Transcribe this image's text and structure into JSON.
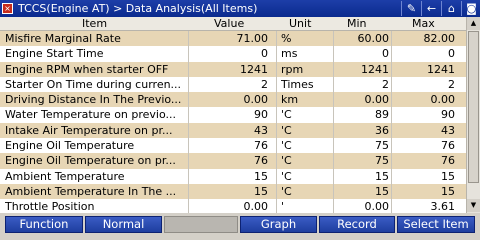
{
  "titlebar": {
    "title": "TCCS(Engine AT) > Data Analysis(All Items)",
    "back_glyph": "×",
    "icons": [
      "pencil-icon",
      "back-arrow-icon",
      "home-icon",
      "camera-icon"
    ],
    "icon_glyphs": [
      "✎",
      "←",
      "⌂",
      "◙"
    ]
  },
  "table": {
    "headers": {
      "item": "Item",
      "value": "Value",
      "unit": "Unit",
      "min": "Min",
      "max": "Max"
    },
    "rows": [
      {
        "item": "Misfire Marginal Rate",
        "value": "71.00",
        "unit": "%",
        "min": "60.00",
        "max": "82.00"
      },
      {
        "item": "Engine Start Time",
        "value": "0",
        "unit": "ms",
        "min": "0",
        "max": "0"
      },
      {
        "item": "Engine RPM when starter OFF",
        "value": "1241",
        "unit": "rpm",
        "min": "1241",
        "max": "1241"
      },
      {
        "item": "Starter On Time during curren...",
        "value": "2",
        "unit": "Times",
        "min": "2",
        "max": "2"
      },
      {
        "item": "Driving Distance In The Previo...",
        "value": "0.00",
        "unit": "km",
        "min": "0.00",
        "max": "0.00"
      },
      {
        "item": "Water Temperature on previo...",
        "value": "90",
        "unit": "'C",
        "min": "89",
        "max": "90"
      },
      {
        "item": "Intake Air Temperature on pr...",
        "value": "43",
        "unit": "'C",
        "min": "36",
        "max": "43"
      },
      {
        "item": "Engine Oil Temperature",
        "value": "76",
        "unit": "'C",
        "min": "75",
        "max": "76"
      },
      {
        "item": "Engine Oil Temperature on pr...",
        "value": "76",
        "unit": "'C",
        "min": "75",
        "max": "76"
      },
      {
        "item": "Ambient Temperature",
        "value": "15",
        "unit": "'C",
        "min": "15",
        "max": "15"
      },
      {
        "item": "Ambient Temperature In The ...",
        "value": "15",
        "unit": "'C",
        "min": "15",
        "max": "15"
      },
      {
        "item": "Throttle Position",
        "value": "0.00",
        "unit": "'",
        "min": "0.00",
        "max": "3.61"
      }
    ]
  },
  "scrollbar": {
    "up_glyph": "▲",
    "down_glyph": "▼"
  },
  "bottombar": {
    "buttons": [
      {
        "label": "Function",
        "enabled": true
      },
      {
        "label": "Normal",
        "enabled": true
      },
      {
        "label": "",
        "enabled": false
      },
      {
        "label": "Graph",
        "enabled": true
      },
      {
        "label": "Record",
        "enabled": true
      },
      {
        "label": "Select Item",
        "enabled": true
      }
    ]
  },
  "colors": {
    "titlebar": "#0a2a8e",
    "row_alt": "#e7d6b5",
    "button": "#2b4bb4"
  }
}
